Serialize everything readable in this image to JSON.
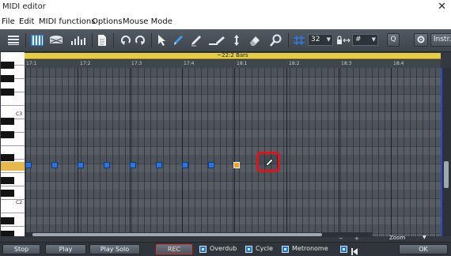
{
  "window": {
    "title": "MIDI editor",
    "close_glyph": "✕"
  },
  "menu": {
    "items": [
      "File",
      "Edit",
      "MIDI functions",
      "Options",
      "Mouse Mode"
    ]
  },
  "toolbar": {
    "icons": [
      "list-icon",
      "piano-roll-icon",
      "drum-editor-icon",
      "velocity-icon",
      "document-icon",
      "undo-icon",
      "redo-icon",
      "arrow-tool-icon",
      "pencil-tool-icon",
      "draw-line-icon",
      "line-tool-icon",
      "move-tool-icon",
      "eraser-icon",
      "zoom-tool-icon"
    ],
    "quantize_value": "32",
    "length_value": "#",
    "quantize_button": "Q",
    "instrument_button": "Instr."
  },
  "timeline": {
    "bar_label": "~22:2 Bars",
    "ticks": [
      "17:1",
      "17:2",
      "17:3",
      "17:4",
      "18:1",
      "18:2",
      "18:3",
      "18:4"
    ]
  },
  "keyboard": {
    "labels": [
      "C3",
      "C2"
    ]
  },
  "notes": {
    "count": 9,
    "active_index": 8,
    "colors": {
      "note": "#2c74dc",
      "active_note": "#f2a020",
      "highlight_box": "#e0131b"
    }
  },
  "zoom": {
    "label": "Zoom"
  },
  "transport": {
    "stop": "Stop",
    "play": "Play",
    "play_solo": "Play Solo",
    "rec": "REC",
    "overdub": "Overdub",
    "cycle": "Cycle",
    "metronome": "Metronome",
    "ok": "OK"
  }
}
